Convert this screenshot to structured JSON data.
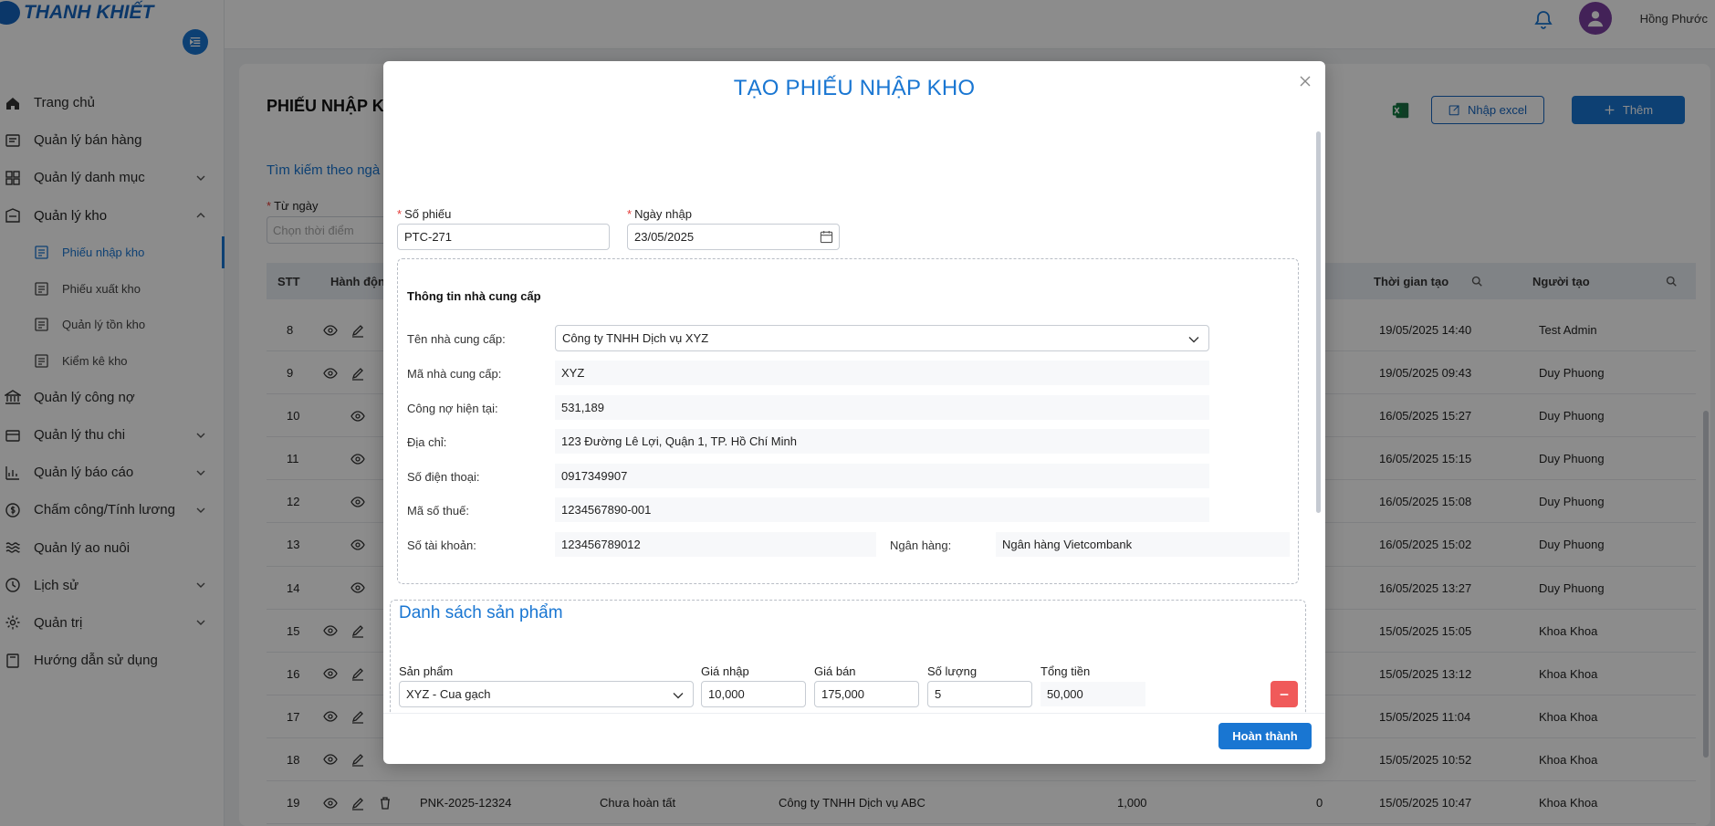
{
  "brand": {
    "name": "THANH KHIẾT"
  },
  "header": {
    "user_name": "Hồng Phước"
  },
  "sidebar": {
    "items": [
      {
        "label": "Trang chủ",
        "icon": "home-icon",
        "has_chevron": false
      },
      {
        "label": "Quản lý bán hàng",
        "icon": "sales-icon",
        "has_chevron": false
      },
      {
        "label": "Quản lý danh mục",
        "icon": "grid-icon",
        "has_chevron": true
      },
      {
        "label": "Quản lý kho",
        "icon": "warehouse-icon",
        "has_chevron": true,
        "open": true
      }
    ],
    "subitems": [
      {
        "label": "Phiếu nhập kho",
        "active": true
      },
      {
        "label": "Phiếu xuất kho",
        "active": false
      },
      {
        "label": "Quản lý tồn kho",
        "active": false
      },
      {
        "label": "Kiểm kê kho",
        "active": false
      }
    ],
    "items_after": [
      {
        "label": "Quản lý công nợ",
        "icon": "bank-icon",
        "has_chevron": false
      },
      {
        "label": "Quản lý thu chi",
        "icon": "wallet-icon",
        "has_chevron": true
      },
      {
        "label": "Quản lý báo cáo",
        "icon": "chart-icon",
        "has_chevron": true
      },
      {
        "label": "Chấm công/Tính lương",
        "icon": "dollar-icon",
        "has_chevron": true
      },
      {
        "label": "Quản lý ao nuôi",
        "icon": "waves-icon",
        "has_chevron": false
      },
      {
        "label": "Lịch sử",
        "icon": "history-icon",
        "has_chevron": true
      },
      {
        "label": "Quản trị",
        "icon": "settings-icon",
        "has_chevron": true
      },
      {
        "label": "Hướng dẫn sử dụng",
        "icon": "book-icon",
        "has_chevron": false
      }
    ]
  },
  "page": {
    "title": "PHIẾU NHẬP K",
    "import_excel_label": "Nhập excel",
    "add_label": "Thêm",
    "search_by_date": "Tìm kiếm theo ngà",
    "from_date_label": "Từ ngày",
    "from_date_placeholder": "Chọn thời điểm"
  },
  "table": {
    "headers": {
      "stt": "STT",
      "actions": "Hành độn",
      "created_time": "Thời gian tạo",
      "creator": "Người tạo"
    },
    "rows": [
      {
        "stt": "8",
        "view": true,
        "edit": true,
        "delete": false,
        "code": "",
        "status": "",
        "supplier": "",
        "amount": "",
        "paid": "",
        "time": "19/05/2025 14:40",
        "creator": "Test Admin"
      },
      {
        "stt": "9",
        "view": true,
        "edit": true,
        "delete": false,
        "code": "",
        "status": "",
        "supplier": "",
        "amount": "",
        "paid": "",
        "time": "19/05/2025 09:43",
        "creator": "Duy Phuong"
      },
      {
        "stt": "10",
        "view": true,
        "edit": false,
        "delete": false,
        "code": "",
        "status": "",
        "supplier": "",
        "amount": "",
        "paid": "",
        "time": "16/05/2025 15:27",
        "creator": "Duy Phuong"
      },
      {
        "stt": "11",
        "view": true,
        "edit": false,
        "delete": false,
        "code": "",
        "status": "",
        "supplier": "",
        "amount": "",
        "paid": "",
        "time": "16/05/2025 15:15",
        "creator": "Duy Phuong"
      },
      {
        "stt": "12",
        "view": true,
        "edit": false,
        "delete": false,
        "code": "",
        "status": "",
        "supplier": "",
        "amount": "",
        "paid": "",
        "time": "16/05/2025 15:08",
        "creator": "Duy Phuong"
      },
      {
        "stt": "13",
        "view": true,
        "edit": false,
        "delete": false,
        "code": "",
        "status": "",
        "supplier": "",
        "amount": "",
        "paid": "",
        "time": "16/05/2025 15:02",
        "creator": "Duy Phuong"
      },
      {
        "stt": "14",
        "view": true,
        "edit": false,
        "delete": false,
        "code": "",
        "status": "",
        "supplier": "",
        "amount": "",
        "paid": "",
        "time": "16/05/2025 13:27",
        "creator": "Duy Phuong"
      },
      {
        "stt": "15",
        "view": true,
        "edit": true,
        "delete": false,
        "code": "",
        "status": "",
        "supplier": "",
        "amount": "",
        "paid": "",
        "time": "15/05/2025 15:05",
        "creator": "Khoa Khoa"
      },
      {
        "stt": "16",
        "view": true,
        "edit": true,
        "delete": false,
        "code": "",
        "status": "",
        "supplier": "",
        "amount": "",
        "paid": "",
        "time": "15/05/2025 13:12",
        "creator": "Khoa Khoa"
      },
      {
        "stt": "17",
        "view": true,
        "edit": true,
        "delete": false,
        "code": "",
        "status": "",
        "supplier": "",
        "amount": "",
        "paid": "",
        "time": "15/05/2025 11:04",
        "creator": "Khoa Khoa"
      },
      {
        "stt": "18",
        "view": true,
        "edit": true,
        "delete": false,
        "code": "",
        "status": "",
        "supplier": "",
        "amount": "",
        "paid": "",
        "time": "15/05/2025 10:52",
        "creator": "Khoa Khoa"
      },
      {
        "stt": "19",
        "view": true,
        "edit": true,
        "delete": true,
        "code": "PNK-2025-12324",
        "status": "Chưa hoàn tất",
        "supplier": "Công ty TNHH Dịch vụ ABC",
        "amount": "1,000",
        "paid": "0",
        "time": "15/05/2025 10:47",
        "creator": "Khoa Khoa"
      }
    ]
  },
  "modal": {
    "title": "TẠO PHIẾU NHẬP KHO",
    "so_phieu_label": "Số phiếu",
    "so_phieu_value": "PTC-271",
    "ngay_nhap_label": "Ngày nhập",
    "ngay_nhap_value": "23/05/2025",
    "supplier_section_title": "Thông tin nhà cung cấp",
    "supplier": {
      "name_label": "Tên nhà cung cấp:",
      "name_value": "Công ty TNHH Dịch vụ XYZ",
      "code_label": "Mã nhà cung cấp:",
      "code_value": "XYZ",
      "debt_label": "Công nợ hiện tại:",
      "debt_value": "531,189",
      "address_label": "Địa chỉ:",
      "address_value": "123 Đường Lê Lợi, Quận 1, TP. Hồ Chí Minh",
      "phone_label": "Số điện thoại:",
      "phone_value": "0917349907",
      "tax_label": "Mã số thuế:",
      "tax_value": "1234567890-001",
      "account_label": "Số tài khoản:",
      "account_value": "123456789012",
      "bank_label": "Ngân hàng:",
      "bank_value": "Ngân hàng Vietcombank"
    },
    "products_title": "Danh sách sản phẩm",
    "product_cols": {
      "product": "Sản phẩm",
      "import_price": "Giá nhập",
      "sale_price": "Giá bán",
      "quantity": "Số lượng",
      "total": "Tổng tiền"
    },
    "product_row": {
      "product": "XYZ - Cua gạch",
      "import_price": "10,000",
      "sale_price": "175,000",
      "quantity": "5",
      "total": "50,000"
    },
    "done_label": "Hoàn thành"
  },
  "colors": {
    "primary": "#1976d2",
    "danger": "#f05a5a",
    "success": "#1a9e1a",
    "required": "#e53935"
  }
}
